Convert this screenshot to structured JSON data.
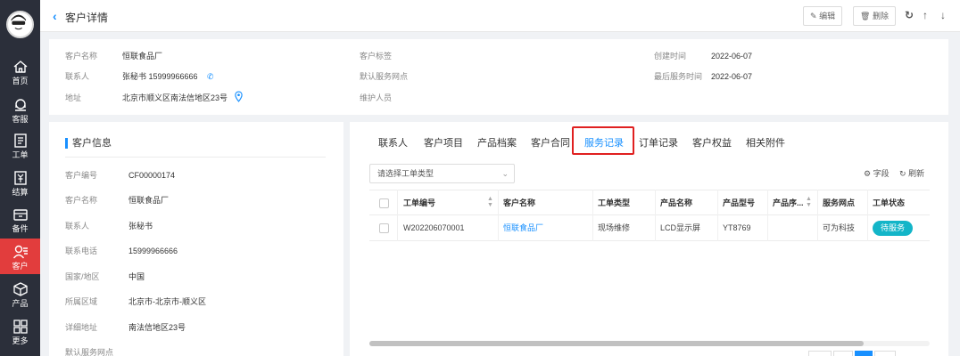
{
  "sidebar": {
    "items": [
      {
        "label": "首页",
        "icon": "home-icon"
      },
      {
        "label": "客服",
        "icon": "headset-icon"
      },
      {
        "label": "工单",
        "icon": "work-order-icon"
      },
      {
        "label": "结算",
        "icon": "settlement-icon"
      },
      {
        "label": "备件",
        "icon": "parts-icon"
      },
      {
        "label": "客户",
        "icon": "customer-icon",
        "active": true
      },
      {
        "label": "产品",
        "icon": "product-icon"
      },
      {
        "label": "更多",
        "icon": "grid-icon"
      }
    ],
    "active_color": "#e23d3d"
  },
  "header": {
    "title": "客户详情",
    "edit_label": "编辑",
    "delete_label": "删除"
  },
  "summary": {
    "name_label": "客户名称",
    "name_value": "恒联食品厂",
    "contact_label": "联系人",
    "contact_value": "张秘书 15999966666",
    "address_label": "地址",
    "address_value": "北京市顺义区南法信地区23号",
    "tags_label": "客户标签",
    "default_site_label": "默认服务网点",
    "maintainer_label": "维护人员",
    "created_label": "创建时间",
    "created_value": "2022-06-07",
    "last_service_label": "最后服务时间",
    "last_service_value": "2022-06-07"
  },
  "info": {
    "title": "客户信息",
    "fields": [
      {
        "label": "客户编号",
        "value": "CF00000174"
      },
      {
        "label": "客户名称",
        "value": "恒联食品厂"
      },
      {
        "label": "联系人",
        "value": "张秘书"
      },
      {
        "label": "联系电话",
        "value": "15999966666"
      },
      {
        "label": "国家/地区",
        "value": "中国"
      },
      {
        "label": "所属区域",
        "value": "北京市-北京市-顺义区"
      },
      {
        "label": "详细地址",
        "value": "南法信地区23号"
      },
      {
        "label": "默认服务网点",
        "value": ""
      }
    ]
  },
  "tabs": [
    {
      "label": "联系人"
    },
    {
      "label": "客户项目"
    },
    {
      "label": "产品档案"
    },
    {
      "label": "客户合同"
    },
    {
      "label": "服务记录",
      "active": true
    },
    {
      "label": "订单记录"
    },
    {
      "label": "客户权益"
    },
    {
      "label": "相关附件"
    }
  ],
  "filter": {
    "placeholder": "请选择工单类型",
    "fields_label": "字段",
    "refresh_label": "刷新"
  },
  "table": {
    "headers": [
      "工单编号",
      "客户名称",
      "工单类型",
      "产品名称",
      "产品型号",
      "产品序...",
      "服务网点",
      "工单状态"
    ],
    "rows": [
      {
        "order_no": "W202206070001",
        "customer": "恒联食品厂",
        "type": "现场维修",
        "product": "LCD显示屏",
        "model": "YT8769",
        "serial": "",
        "site": "可为科技",
        "status": "待服务"
      }
    ],
    "status_color": "#13b5c8",
    "link_color": "#1890ff"
  }
}
